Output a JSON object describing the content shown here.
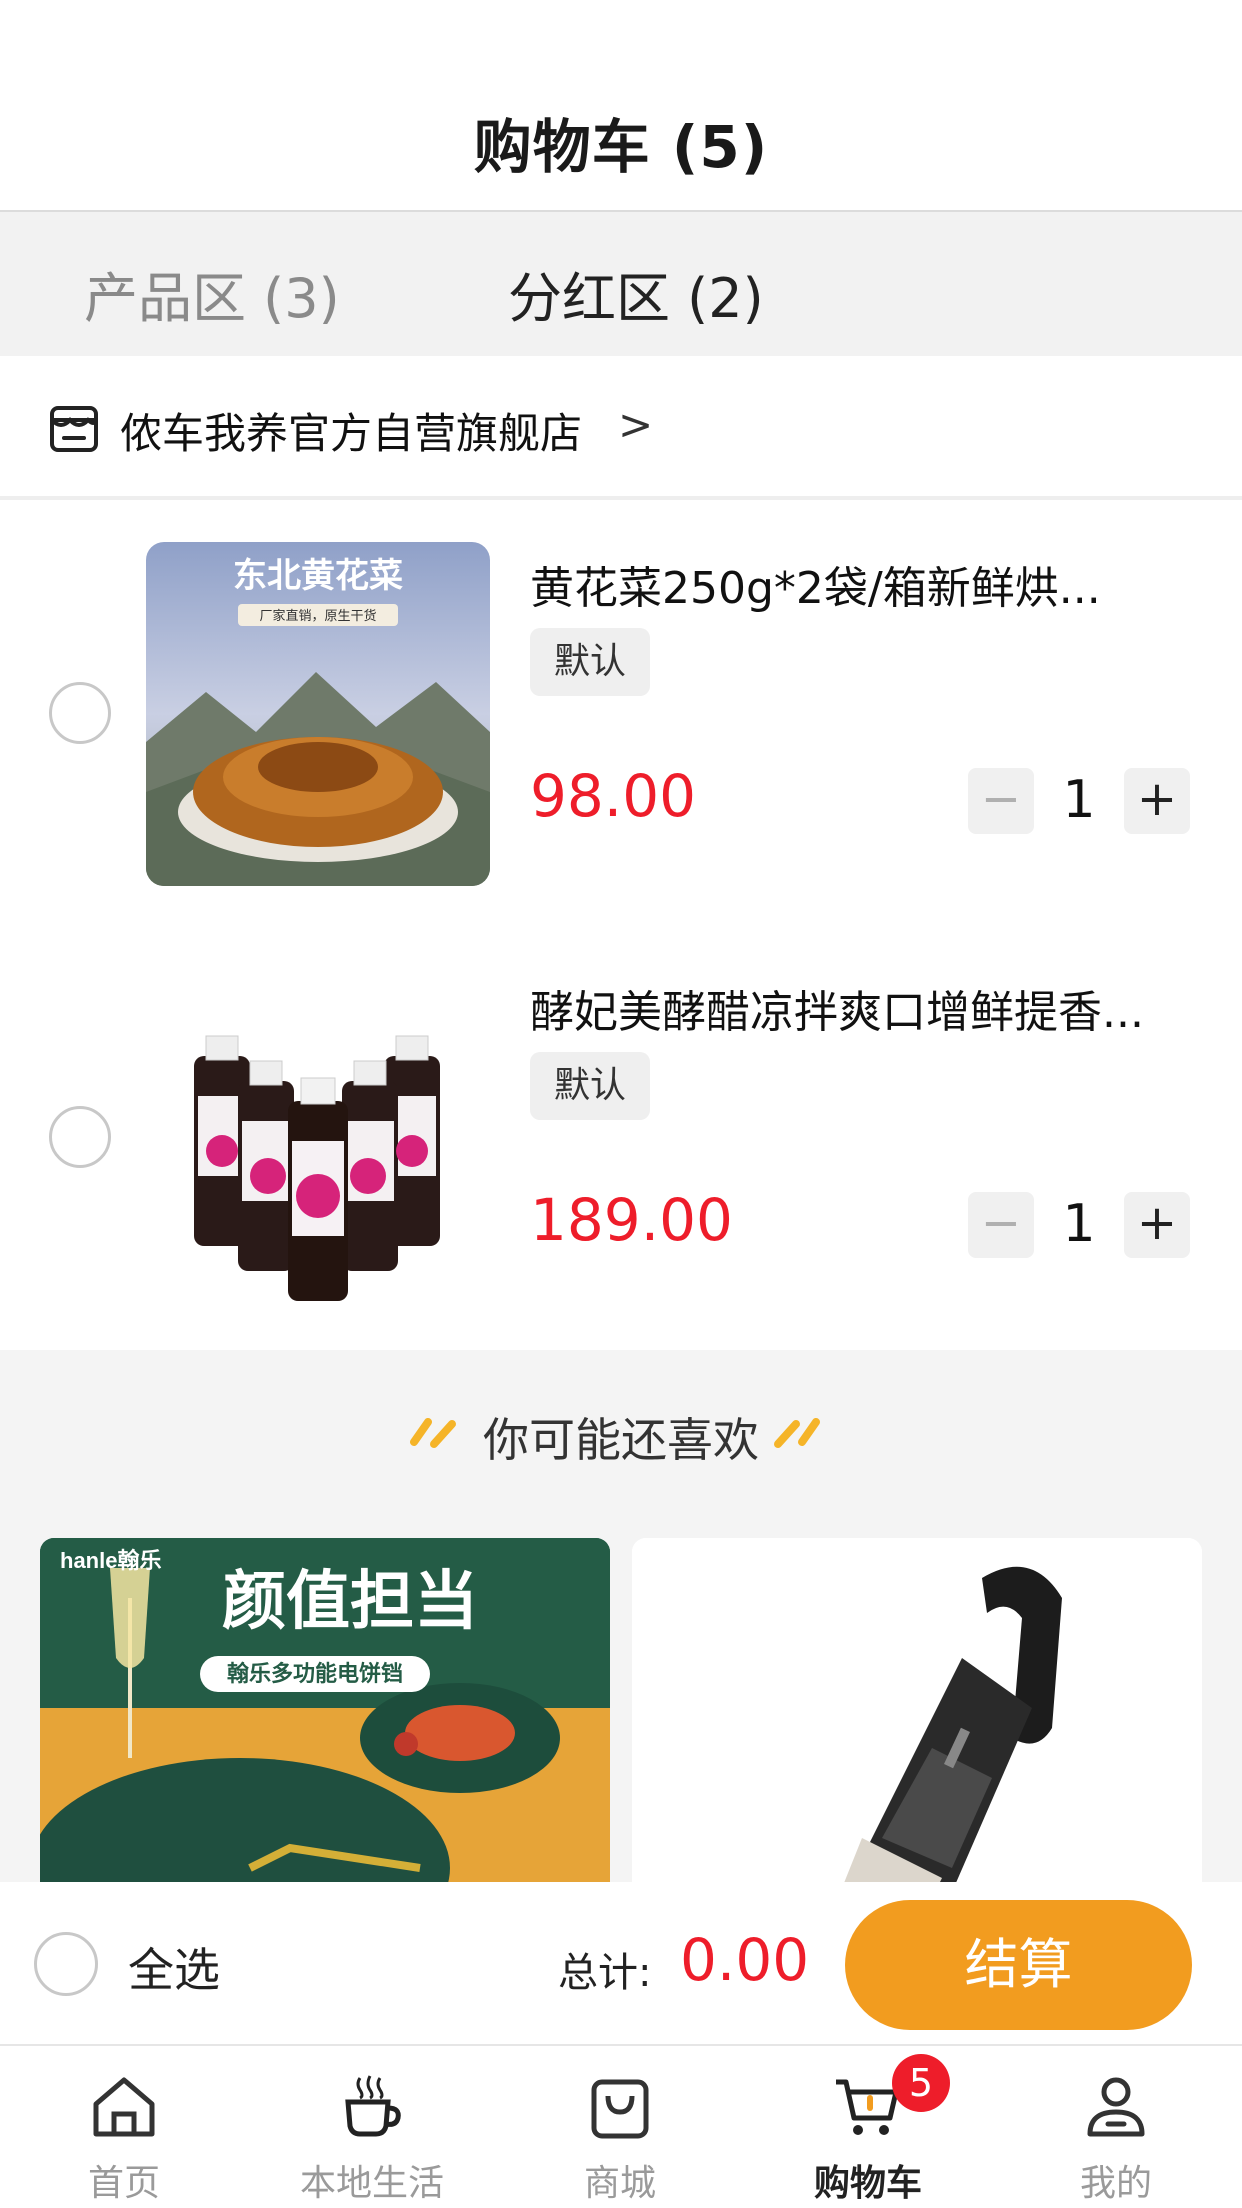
{
  "header": {
    "title": "购物车 (5)"
  },
  "tabs": [
    {
      "label": "产品区 (3)"
    },
    {
      "label": "分红区 (2)"
    }
  ],
  "store": {
    "name": "侬车我养官方自营旗舰店",
    "chevron": ">"
  },
  "items": [
    {
      "name": "黄花菜250g*2袋/箱新鲜烘...",
      "spec": "默认",
      "price": "98.00",
      "qty": "1",
      "thumb_text": "东北黄花菜",
      "thumb_sub": "厂家直销，原生干货"
    },
    {
      "name": "酵妃美酵醋凉拌爽口增鲜提香...",
      "spec": "默认",
      "price": "189.00",
      "qty": "1"
    }
  ],
  "qty_controls": {
    "minus": "−",
    "plus": "+"
  },
  "recommend": {
    "title": "你可能还喜欢",
    "cards": [
      {
        "brand": "hanle翰乐",
        "headline": "颜值担当",
        "subline": "翰乐多功能电饼铛"
      },
      {
        "alt": "handheld-vacuum"
      }
    ]
  },
  "footer": {
    "select_all": "全选",
    "total_label": "总计:",
    "total": "0.00",
    "checkout": "结算"
  },
  "tabbar": {
    "items": [
      {
        "label": "首页",
        "icon": "home-icon"
      },
      {
        "label": "本地生活",
        "icon": "coffee-icon"
      },
      {
        "label": "商城",
        "icon": "shopping-bag-icon"
      },
      {
        "label": "购物车",
        "icon": "cart-icon"
      },
      {
        "label": "我的",
        "icon": "user-icon"
      }
    ],
    "cart_badge": "5"
  },
  "colors": {
    "accent": "#f29c1f",
    "price": "#ee1d2a"
  }
}
